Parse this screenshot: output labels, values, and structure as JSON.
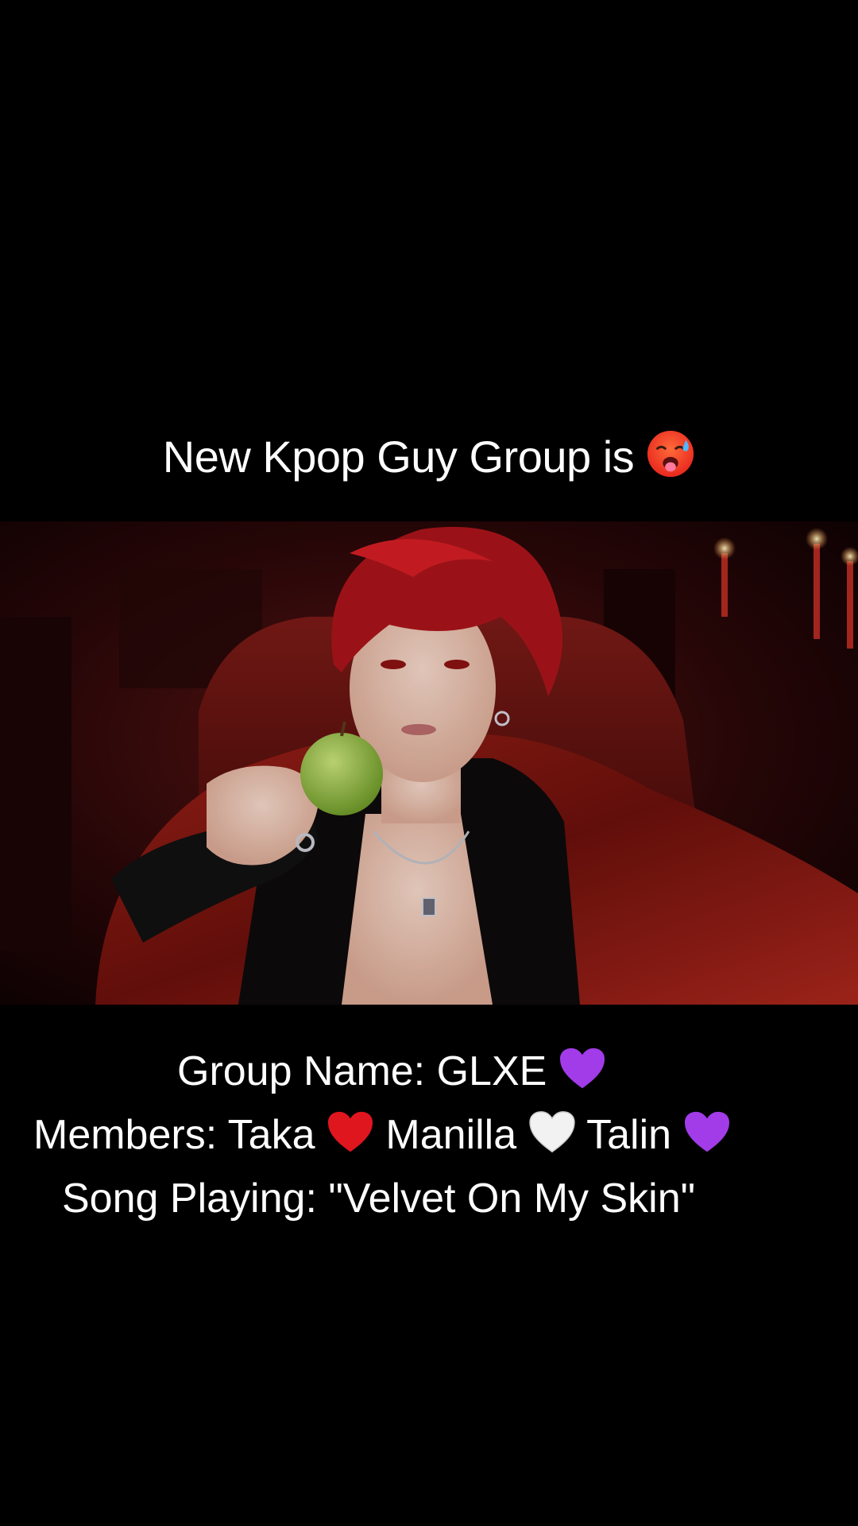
{
  "headline": {
    "text": "New Kpop Guy Group is",
    "emoji_icon": "hot-face-emoji"
  },
  "photo": {
    "icon": "idol-portrait-image"
  },
  "caption": {
    "group_label": "Group Name: GLXE",
    "group_emoji": "purple-heart",
    "members_prefix": "Members:",
    "members": [
      {
        "name": "Taka",
        "heart": "red-heart"
      },
      {
        "name": "Manilla",
        "heart": "white-heart"
      },
      {
        "name": "Talin",
        "heart": "purple-heart"
      }
    ],
    "song_line": "Song Playing: \"Velvet On My Skin\""
  },
  "colors": {
    "background": "#000000",
    "text": "#ffffff",
    "red_heart": "#e0161f",
    "purple_heart": "#a23be8",
    "white_heart": "#f2f2f2"
  }
}
